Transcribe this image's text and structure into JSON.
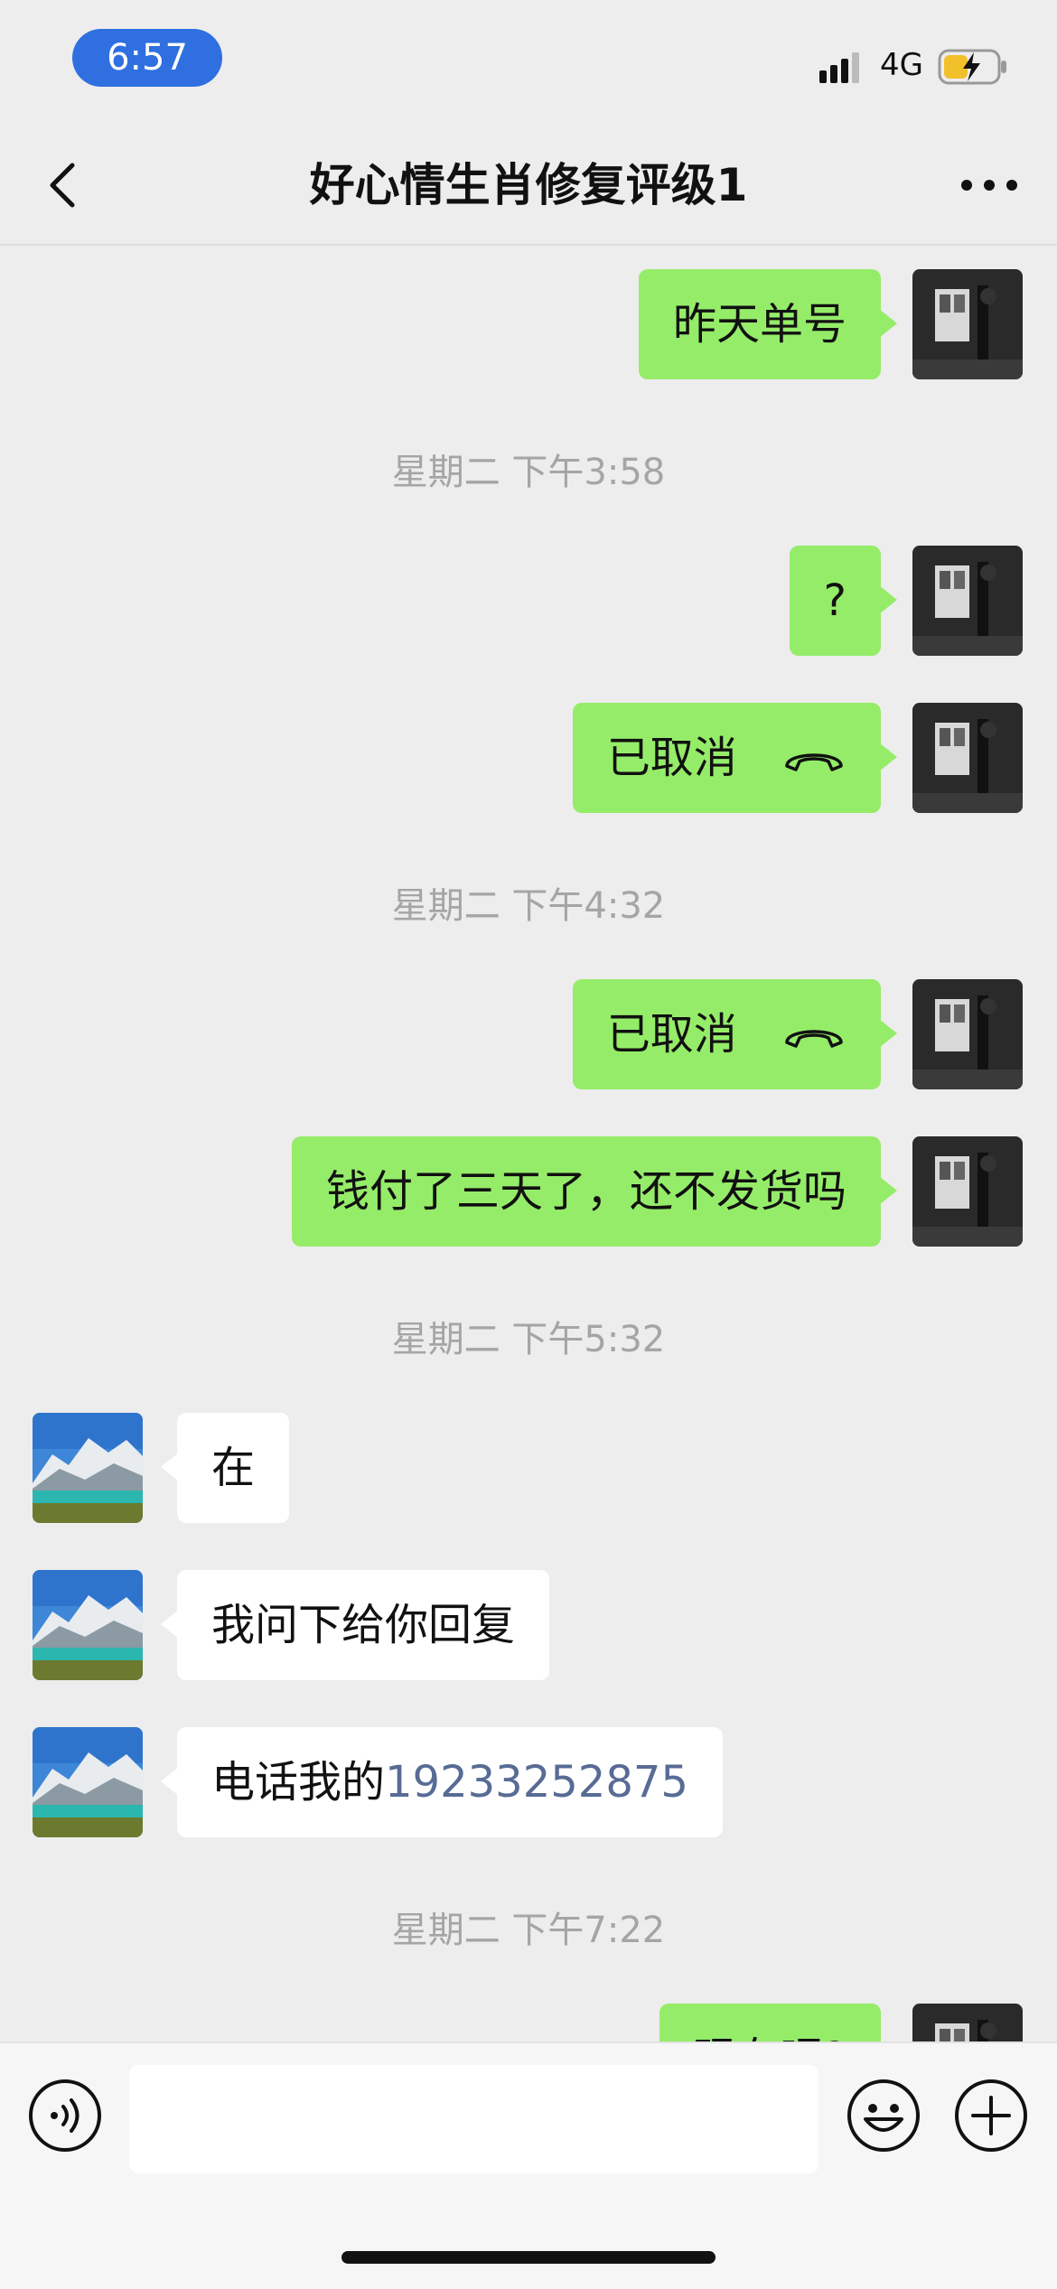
{
  "status_bar": {
    "time": "6:57",
    "network": "4G"
  },
  "header": {
    "title": "好心情生肖修复评级1"
  },
  "messages": [
    {
      "text": "昨天单号"
    },
    {
      "timestamp": "星期二 下午3:58"
    },
    {
      "text": "?"
    },
    {
      "text": "已取消"
    },
    {
      "timestamp": "星期二 下午4:32"
    },
    {
      "text": "已取消"
    },
    {
      "text": "钱付了三天了，还不发货吗"
    },
    {
      "timestamp": "星期二 下午5:32"
    },
    {
      "text": "在"
    },
    {
      "text": "我问下给你回复"
    },
    {
      "text": "电话我的",
      "phone": "19233252875"
    },
    {
      "timestamp": "星期二 下午7:22"
    },
    {
      "text": "现在呢?"
    }
  ],
  "icons": {
    "back": "chevron-left-icon",
    "more": "more-dots-icon",
    "voice": "voice-icon",
    "emoji": "emoji-icon",
    "plus": "plus-icon",
    "call": "phone-hangup-icon"
  },
  "colors": {
    "outgoing_bubble": "#95ec69",
    "incoming_bubble": "#ffffff",
    "chat_background": "#ededed",
    "link": "#576b95",
    "time_pill": "#2f6fe0"
  }
}
